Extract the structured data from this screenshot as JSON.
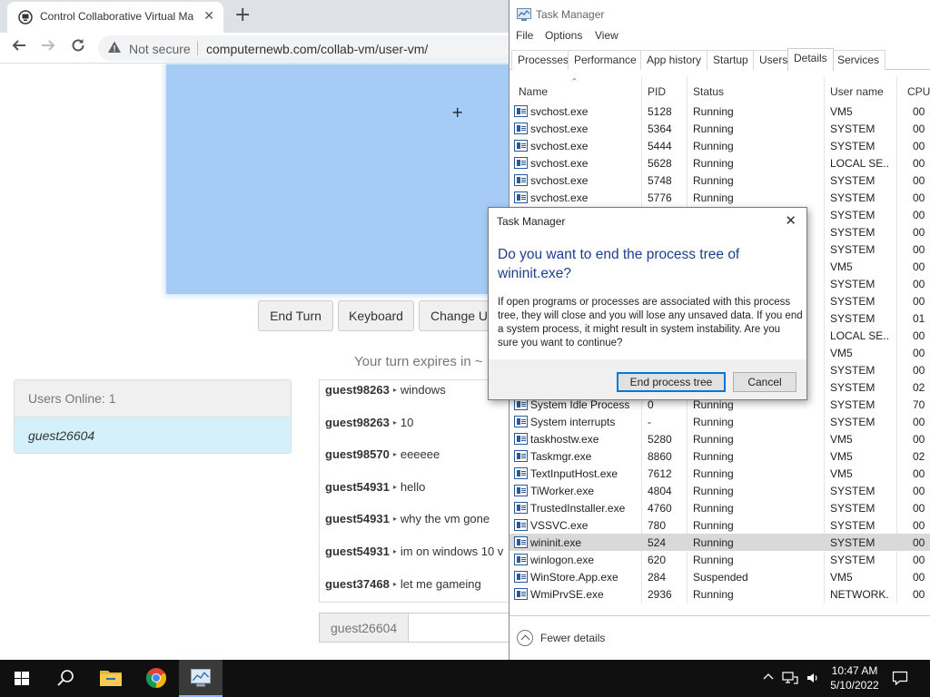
{
  "browser": {
    "tab_title": "Control Collaborative Virtual Ma",
    "tab_close": "✕",
    "newtab": "+",
    "not_secure": "Not secure",
    "url": "computernewb.com/collab-vm/user-vm/"
  },
  "vm": {
    "crosshair": "+",
    "buttons": {
      "end_turn": "End Turn",
      "keyboard": "Keyboard",
      "change_username": "Change U"
    },
    "turn_text": "Your turn expires in ~",
    "users_online": "Users Online: 1",
    "users": [
      "guest26604"
    ],
    "chat": [
      {
        "user": "guest98263",
        "text": "windows"
      },
      {
        "user": "guest98263",
        "text": "10"
      },
      {
        "user": "guest98570",
        "text": "eeeeee"
      },
      {
        "user": "guest54931",
        "text": "hello"
      },
      {
        "user": "guest54931",
        "text": "why the vm gone"
      },
      {
        "user": "guest54931",
        "text": "im on windows 10 v"
      },
      {
        "user": "guest37468",
        "text": "let me gameing"
      }
    ],
    "chat_name": "guest26604",
    "chat_arrow": "▸"
  },
  "taskmgr": {
    "title": "Task Manager",
    "menu": [
      "File",
      "Options",
      "View"
    ],
    "tabs": [
      "Processes",
      "Performance",
      "App history",
      "Startup",
      "Users",
      "Details",
      "Services"
    ],
    "active_tab": "Details",
    "columns": {
      "name": "Name",
      "pid": "PID",
      "status": "Status",
      "user": "User name",
      "cpu": "CPU"
    },
    "rows": [
      {
        "name": "svchost.exe",
        "pid": "5128",
        "status": "Running",
        "user": "VM5",
        "cpu": "00"
      },
      {
        "name": "svchost.exe",
        "pid": "5364",
        "status": "Running",
        "user": "SYSTEM",
        "cpu": "00"
      },
      {
        "name": "svchost.exe",
        "pid": "5444",
        "status": "Running",
        "user": "SYSTEM",
        "cpu": "00"
      },
      {
        "name": "svchost.exe",
        "pid": "5628",
        "status": "Running",
        "user": "LOCAL SE...",
        "cpu": "00"
      },
      {
        "name": "svchost.exe",
        "pid": "5748",
        "status": "Running",
        "user": "SYSTEM",
        "cpu": "00"
      },
      {
        "name": "svchost.exe",
        "pid": "5776",
        "status": "Running",
        "user": "SYSTEM",
        "cpu": "00"
      },
      {
        "name": "",
        "pid": "",
        "status": "",
        "user": "SYSTEM",
        "cpu": "00"
      },
      {
        "name": "",
        "pid": "",
        "status": "",
        "user": "SYSTEM",
        "cpu": "00"
      },
      {
        "name": "",
        "pid": "",
        "status": "",
        "user": "SYSTEM",
        "cpu": "00"
      },
      {
        "name": "",
        "pid": "",
        "status": "",
        "user": "VM5",
        "cpu": "00"
      },
      {
        "name": "",
        "pid": "",
        "status": "",
        "user": "SYSTEM",
        "cpu": "00"
      },
      {
        "name": "",
        "pid": "",
        "status": "",
        "user": "SYSTEM",
        "cpu": "00"
      },
      {
        "name": "",
        "pid": "",
        "status": "",
        "user": "SYSTEM",
        "cpu": "01"
      },
      {
        "name": "",
        "pid": "",
        "status": "",
        "user": "LOCAL SE...",
        "cpu": "00"
      },
      {
        "name": "",
        "pid": "",
        "status": "",
        "user": "VM5",
        "cpu": "00"
      },
      {
        "name": "",
        "pid": "",
        "status": "",
        "user": "SYSTEM",
        "cpu": "00"
      },
      {
        "name": "",
        "pid": "",
        "status": "",
        "user": "SYSTEM",
        "cpu": "02"
      },
      {
        "name": "System Idle Process",
        "pid": "0",
        "status": "Running",
        "user": "SYSTEM",
        "cpu": "70"
      },
      {
        "name": "System interrupts",
        "pid": "-",
        "status": "Running",
        "user": "SYSTEM",
        "cpu": "00"
      },
      {
        "name": "taskhostw.exe",
        "pid": "5280",
        "status": "Running",
        "user": "VM5",
        "cpu": "00"
      },
      {
        "name": "Taskmgr.exe",
        "pid": "8860",
        "status": "Running",
        "user": "VM5",
        "cpu": "02"
      },
      {
        "name": "TextInputHost.exe",
        "pid": "7612",
        "status": "Running",
        "user": "VM5",
        "cpu": "00"
      },
      {
        "name": "TiWorker.exe",
        "pid": "4804",
        "status": "Running",
        "user": "SYSTEM",
        "cpu": "00"
      },
      {
        "name": "TrustedInstaller.exe",
        "pid": "4760",
        "status": "Running",
        "user": "SYSTEM",
        "cpu": "00"
      },
      {
        "name": "VSSVC.exe",
        "pid": "780",
        "status": "Running",
        "user": "SYSTEM",
        "cpu": "00"
      },
      {
        "name": "wininit.exe",
        "pid": "524",
        "status": "Running",
        "user": "SYSTEM",
        "cpu": "00",
        "selected": true
      },
      {
        "name": "winlogon.exe",
        "pid": "620",
        "status": "Running",
        "user": "SYSTEM",
        "cpu": "00"
      },
      {
        "name": "WinStore.App.exe",
        "pid": "284",
        "status": "Suspended",
        "user": "VM5",
        "cpu": "00"
      },
      {
        "name": "WmiPrvSE.exe",
        "pid": "2936",
        "status": "Running",
        "user": "NETWORK...",
        "cpu": "00"
      }
    ],
    "fewer_details": "Fewer details"
  },
  "dialog": {
    "title": "Task Manager",
    "close": "✕",
    "heading": "Do you want to end the process tree of wininit.exe?",
    "body": "If open programs or processes are associated with this process tree, they will close and you will lose any unsaved data. If you end a system process, it might result in system instability. Are you sure you want to continue?",
    "ok_label": "End process tree",
    "cancel_label": "Cancel"
  },
  "taskbar": {
    "time": "10:47 AM",
    "date": "5/10/2022"
  },
  "icons": {
    "favicon": "collabvm-logo-icon",
    "back": "back-arrow-icon",
    "forward": "forward-arrow-icon",
    "reload": "reload-icon",
    "warning": "warning-triangle-icon",
    "start": "windows-logo-icon",
    "search": "search-icon",
    "explorer": "folder-icon",
    "chrome": "chrome-icon",
    "taskmgr": "task-manager-icon"
  }
}
